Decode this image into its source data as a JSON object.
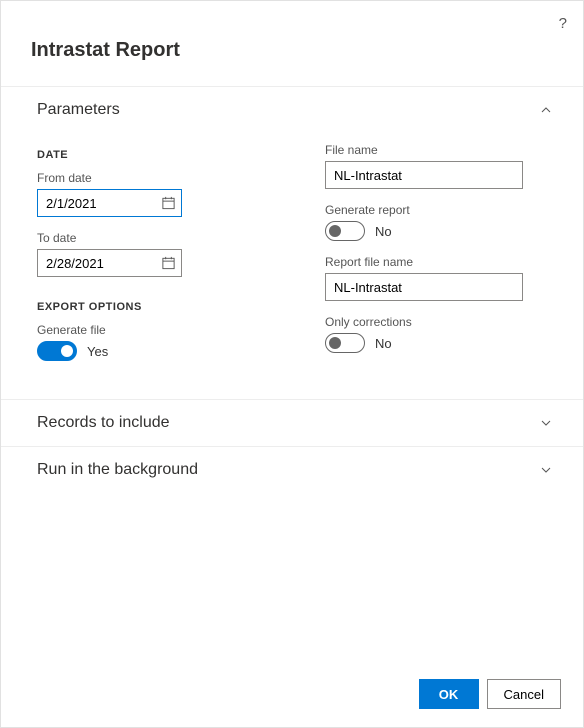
{
  "title": "Intrastat Report",
  "help_tooltip": "?",
  "sections": {
    "parameters": {
      "title": "Parameters",
      "date_heading": "DATE",
      "from_date_label": "From date",
      "from_date_value": "2/1/2021",
      "to_date_label": "To date",
      "to_date_value": "2/28/2021",
      "export_heading": "EXPORT OPTIONS",
      "generate_file_label": "Generate file",
      "generate_file_state": "Yes",
      "file_name_label": "File name",
      "file_name_value": "NL-Intrastat",
      "generate_report_label": "Generate report",
      "generate_report_state": "No",
      "report_file_name_label": "Report file name",
      "report_file_name_value": "NL-Intrastat",
      "only_corrections_label": "Only corrections",
      "only_corrections_state": "No"
    },
    "records": {
      "title": "Records to include"
    },
    "background": {
      "title": "Run in the background"
    }
  },
  "footer": {
    "ok": "OK",
    "cancel": "Cancel"
  }
}
